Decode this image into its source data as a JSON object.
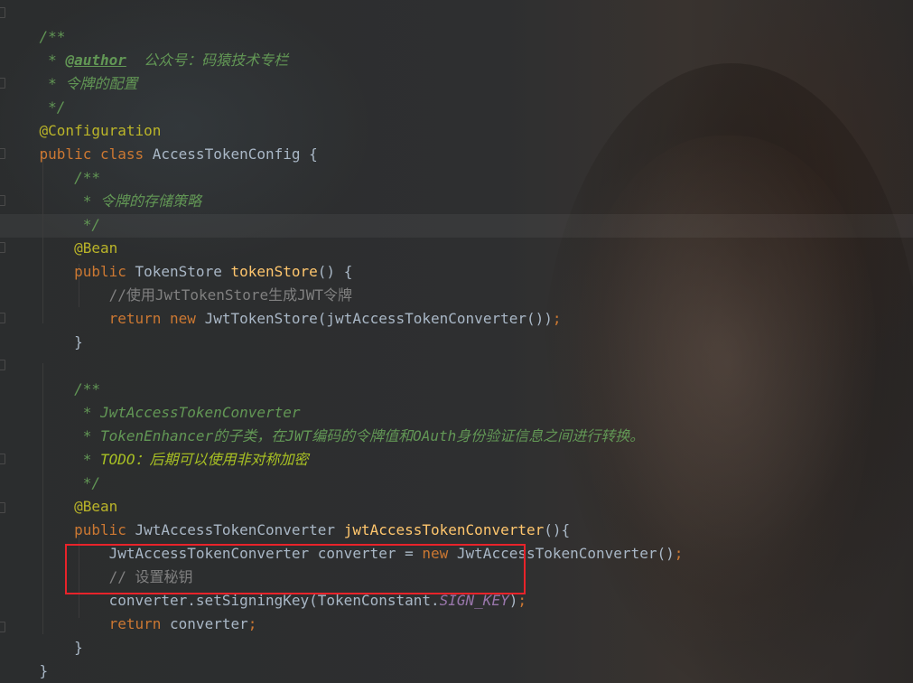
{
  "code": {
    "l1": {
      "a": "/**"
    },
    "l2": {
      "a": " * ",
      "b": "@author",
      "c": "  公众号：码猿技术专栏"
    },
    "l3": {
      "a": " * 令牌的配置"
    },
    "l4": {
      "a": " */"
    },
    "l5": {
      "a": "@Configuration"
    },
    "l6": {
      "a": "public class ",
      "b": "AccessTokenConfig {"
    },
    "l7": {
      "a": "    /**"
    },
    "l8": {
      "a": "     * 令牌的存储策略"
    },
    "l9": {
      "a": "     */"
    },
    "l10": {
      "a": "    @Bean"
    },
    "l11": {
      "a": "    public ",
      "b": "TokenStore ",
      "c": "tokenStore",
      "d": "() {"
    },
    "l12": {
      "a": "        //使用JwtTokenStore生成JWT令牌"
    },
    "l13": {
      "a": "        return new ",
      "b": "JwtTokenStore(jwtAccessTokenConverter())",
      "c": ";"
    },
    "l14": {
      "a": "    }"
    },
    "l16": {
      "a": "    /**"
    },
    "l17": {
      "a": "     * JwtAccessTokenConverter"
    },
    "l18": {
      "a": "     * TokenEnhancer的子类，在JWT编码的令牌值和OAuth身份验证信息之间进行转换。"
    },
    "l19": {
      "a": "     * ",
      "b": "TODO：后期可以使用非对称加密"
    },
    "l20": {
      "a": "     */"
    },
    "l21": {
      "a": "    @Bean"
    },
    "l22": {
      "a": "    public ",
      "b": "JwtAccessTokenConverter ",
      "c": "jwtAccessTokenConverter",
      "d": "(){"
    },
    "l23": {
      "a": "        JwtAccessTokenConverter converter = ",
      "b": "new ",
      "c": "JwtAccessTokenConverter()",
      "d": ";"
    },
    "l24": {
      "a": "        // 设置秘钥"
    },
    "l25": {
      "a": "        converter.setSigningKey(TokenConstant.",
      "b": "SIGN_KEY",
      "c": ")",
      "d": ";"
    },
    "l26": {
      "a": "        return ",
      "b": "converter",
      "c": ";"
    },
    "l27": {
      "a": "    }"
    },
    "l28": {
      "a": "}"
    }
  },
  "colors": {
    "comment": "#629755",
    "keyword": "#cc7832",
    "annotation": "#bbb529",
    "method": "#ffc66d",
    "constant": "#9876aa",
    "text": "#a9b7c6",
    "highlight_box": "#e8232a"
  }
}
